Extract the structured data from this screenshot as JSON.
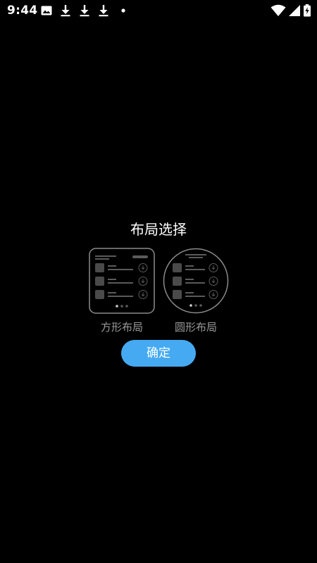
{
  "status_bar": {
    "time": "9:44",
    "icons": [
      "image-icon",
      "download-icon",
      "download-icon",
      "download-icon",
      "dot-icon",
      "wifi-icon",
      "signal-icon",
      "battery-charging-icon"
    ]
  },
  "dialog": {
    "title": "布局选择",
    "options": [
      {
        "label": "方形布局",
        "shape": "square"
      },
      {
        "label": "圆形布局",
        "shape": "round"
      }
    ],
    "confirm_label": "确定"
  },
  "colors": {
    "background": "#000000",
    "accent": "#45aaf2",
    "label": "#9a9a9a",
    "preview_outline": "#8a8a8a"
  }
}
